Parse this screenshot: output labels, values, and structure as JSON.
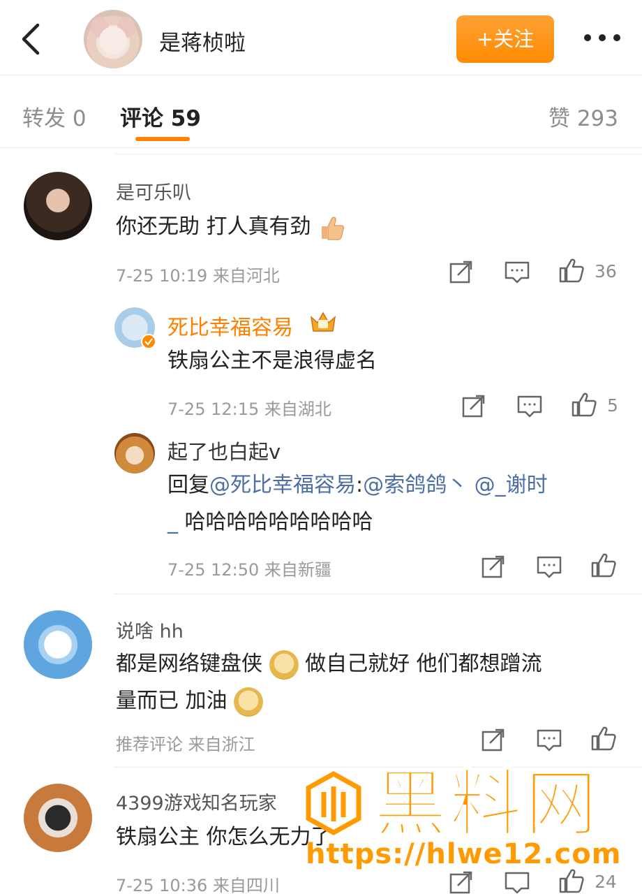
{
  "header": {
    "title": "是蒋桢啦",
    "follow_label": "+关注"
  },
  "tabs": {
    "forward": "转发 0",
    "comments": "评论 59",
    "likes": "赞 293"
  },
  "comments": [
    {
      "user": "是可乐叭",
      "text": "你还无助 打人真有劲",
      "time": "7-25 10:19",
      "location": "来自河北",
      "likes": "36"
    },
    {
      "user": "说啥 hh",
      "text_1": "都是网络键盘侠",
      "text_2": "做自己就好 他们都想蹭流",
      "text_3": "量而已 加油",
      "time": "推荐评论",
      "location": "来自浙江"
    },
    {
      "user": "4399游戏知名玩家",
      "text": "铁扇公主 你怎么无力了",
      "time": "7-25 10:36",
      "location": "来自四川",
      "likes": "24"
    }
  ],
  "replies": [
    {
      "user": "死比幸福容易",
      "text": "铁扇公主不是浪得虚名",
      "time": "7-25 12:15",
      "location": "来自湖北",
      "likes": "5"
    },
    {
      "user": "起了也白起v",
      "reply_prefix": "回复",
      "mention_1": "@死比幸福容易",
      "colon": ":",
      "mention_2": "@索鸽鸽丶",
      "mention_3": "@_谢时",
      "mention_3b": "_",
      "text": "哈哈哈哈哈哈哈哈哈",
      "time": "7-25 12:50",
      "location": "来自新疆"
    }
  ],
  "watermark": {
    "title": "黑料网",
    "url": "https://hlwe12.com"
  },
  "colors": {
    "accent": "#ff8200",
    "mention": "#4c6fa6",
    "watermark": "#ff9a00"
  },
  "icons": [
    "back-arrow-icon",
    "more-dots-icon",
    "share-icon",
    "comment-icon",
    "like-icon",
    "thumbs-up-emoji",
    "doge-emoji",
    "crown-badge-icon",
    "verified-badge-icon"
  ]
}
